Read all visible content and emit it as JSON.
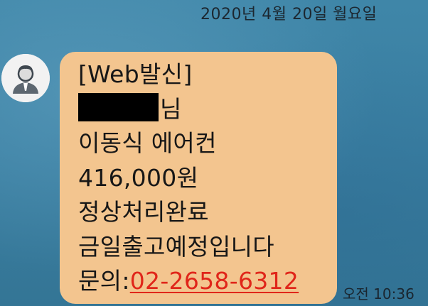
{
  "header": {
    "date": "2020년 4월 20일 월요일"
  },
  "message": {
    "sender_avatar_icon": "default-user-avatar-icon",
    "bubble_color": "#f3c58f",
    "lines": {
      "source": "[Web발신]",
      "recipient_suffix": "님",
      "product": "이동식 에어컨",
      "amount": "416,000원",
      "status": "정상처리완료",
      "shipping": "금일출고예정입니다",
      "inquiry_label": "문의:",
      "inquiry_phone": "02-2658-6312"
    },
    "link_color": "#e0261a",
    "timestamp": "오전 10:36"
  }
}
